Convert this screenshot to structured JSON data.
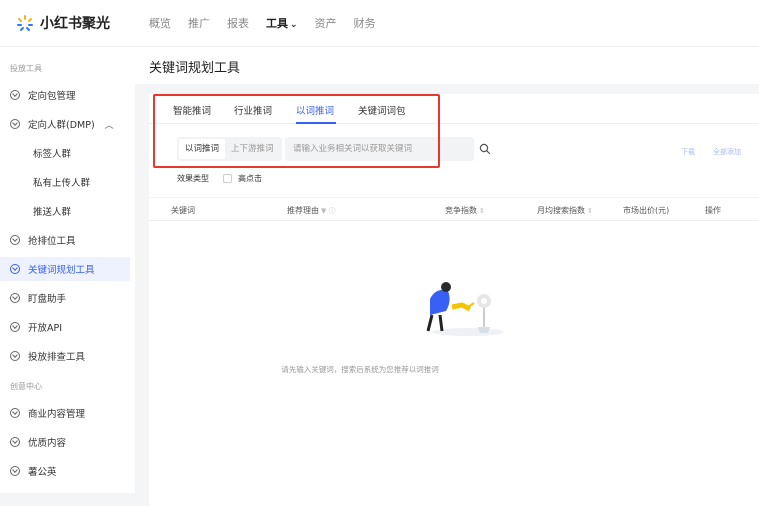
{
  "app": {
    "logo_text": "小红书聚光"
  },
  "topnav": [
    {
      "label": "概览"
    },
    {
      "label": "推广"
    },
    {
      "label": "报表"
    },
    {
      "label": "工具",
      "active": true
    },
    {
      "label": "资产"
    },
    {
      "label": "财务"
    }
  ],
  "sidebar": {
    "section1": "投放工具",
    "items": [
      {
        "label": "定向包管理"
      },
      {
        "label": "定向人群(DMP)"
      },
      {
        "label": "标签人群"
      },
      {
        "label": "私有上传人群"
      },
      {
        "label": "推送人群"
      },
      {
        "label": "抢排位工具"
      },
      {
        "label": "关键词规划工具"
      },
      {
        "label": "盯盘助手"
      },
      {
        "label": "开放API"
      },
      {
        "label": "投放排查工具"
      }
    ],
    "section2": "创意中心",
    "items2": [
      {
        "label": "商业内容管理"
      },
      {
        "label": "优质内容"
      },
      {
        "label": "薯公英"
      }
    ]
  },
  "page": {
    "title": "关键词规划工具"
  },
  "tabs": [
    {
      "label": "智能推词"
    },
    {
      "label": "行业推词"
    },
    {
      "label": "以词推词",
      "active": true
    },
    {
      "label": "关键词词包"
    }
  ],
  "segment": [
    {
      "label": "以词推词",
      "active": true
    },
    {
      "label": "上下游推词"
    }
  ],
  "search": {
    "placeholder": "请输入业务相关词以获取关键词"
  },
  "right_actions": {
    "download": "下载",
    "add_all": "全部添加"
  },
  "filter": {
    "label": "效果类型",
    "option": "高点击"
  },
  "table": {
    "headers": [
      "关键词",
      "推荐理由",
      "竞争指数",
      "月均搜索指数",
      "市场出价(元)",
      "操作"
    ]
  },
  "empty": {
    "text": "请先输入关键词，搜索后系统为您推荐以词推词"
  },
  "colors": {
    "accent": "#3860f4",
    "highlight": "#e8372c"
  }
}
